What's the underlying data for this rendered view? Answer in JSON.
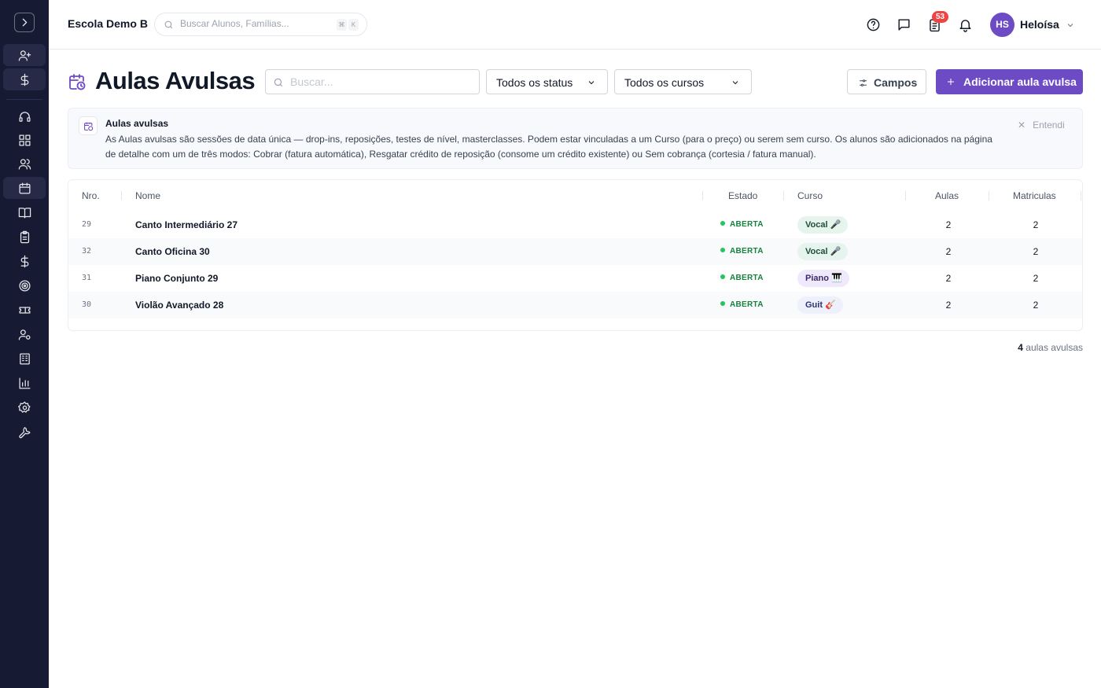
{
  "topbar": {
    "school_name": "Escola Demo B",
    "search_placeholder": "Buscar Alunos, Famílias...",
    "kbd_keys": [
      "⌘",
      "K"
    ],
    "notification_count": "53",
    "user_initials": "HS",
    "user_name": "Heloísa"
  },
  "page": {
    "title": "Aulas Avulsas",
    "search_placeholder": "Buscar...",
    "status_filter": "Todos os status",
    "course_filter": "Todos os cursos",
    "fields_button": "Campos",
    "add_button": "Adicionar aula avulsa"
  },
  "banner": {
    "title": "Aulas avulsas",
    "text": "As Aulas avulsas são sessões de data única — drop-ins, reposições, testes de nível, masterclasses. Podem estar vinculadas a um Curso (para o preço) ou serem sem curso. Os alunos são adicionados na página de detalhe com um de três modos: Cobrar (fatura automática), Resgatar crédito de reposição (consome um crédito existente) ou Sem cobrança (cortesia / fatura manual).",
    "dismiss_label": "Entendi"
  },
  "table": {
    "columns": [
      "Nro.",
      "Nome",
      "Estado",
      "Curso",
      "Aulas",
      "Matriculas"
    ],
    "rows": [
      {
        "nro": "29",
        "nome": "Canto Intermediário 27",
        "estado": "ABERTA",
        "curso": "Vocal 🎤",
        "aulas": "2",
        "matriculas": "2"
      },
      {
        "nro": "32",
        "nome": "Canto Oficina 30",
        "estado": "ABERTA",
        "curso": "Vocal 🎤",
        "aulas": "2",
        "matriculas": "2"
      },
      {
        "nro": "31",
        "nome": "Piano Conjunto 29",
        "estado": "ABERTA",
        "curso": "Piano 🎹",
        "aulas": "2",
        "matriculas": "2"
      },
      {
        "nro": "30",
        "nome": "Violão Avançado 28",
        "estado": "ABERTA",
        "curso": "Guit 🎸",
        "aulas": "2",
        "matriculas": "2"
      }
    ],
    "footer_count": "4",
    "footer_label": "aulas avulsas"
  },
  "colors": {
    "accent": "#6d4bc4",
    "sidebar_bg": "#161a33",
    "status_green": "#16803c",
    "chip_vocal_bg": "#e6f4ee",
    "chip_piano_bg": "#efe9fb",
    "chip_guit_bg": "#eef0fb"
  },
  "sidebar_icons": [
    "chevron-right-icon",
    "user-plus-icon",
    "dollar-icon",
    "headset-icon",
    "dashboard-icon",
    "users-icon",
    "calendar-icon",
    "book-icon",
    "clipboard-icon",
    "dollar-icon",
    "target-icon",
    "ticket-icon",
    "user-settings-icon",
    "building-icon",
    "bar-chart-icon",
    "gear-icon",
    "wrench-icon"
  ]
}
